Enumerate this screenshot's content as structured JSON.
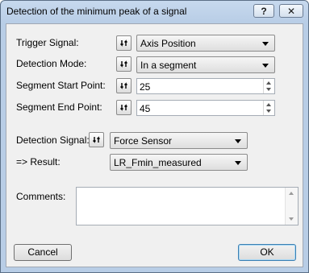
{
  "window": {
    "title": "Detection of the minimum peak of a signal",
    "help_label": "?",
    "close_label": "✕"
  },
  "form": {
    "trigger_signal": {
      "label": "Trigger Signal:",
      "value": "Axis Position"
    },
    "detection_mode": {
      "label": "Detection Mode:",
      "value": "In a segment"
    },
    "segment_start": {
      "label": "Segment Start Point:",
      "value": "25"
    },
    "segment_end": {
      "label": "Segment End Point:",
      "value": "45"
    },
    "detection_signal": {
      "label": "Detection Signal:",
      "value": "Force Sensor"
    },
    "result": {
      "label": "=> Result:",
      "value": "LR_Fmin_measured"
    },
    "comments": {
      "label": "Comments:",
      "value": ""
    }
  },
  "buttons": {
    "cancel": "Cancel",
    "ok": "OK"
  },
  "icons": {
    "refresh": "refresh-icon"
  }
}
